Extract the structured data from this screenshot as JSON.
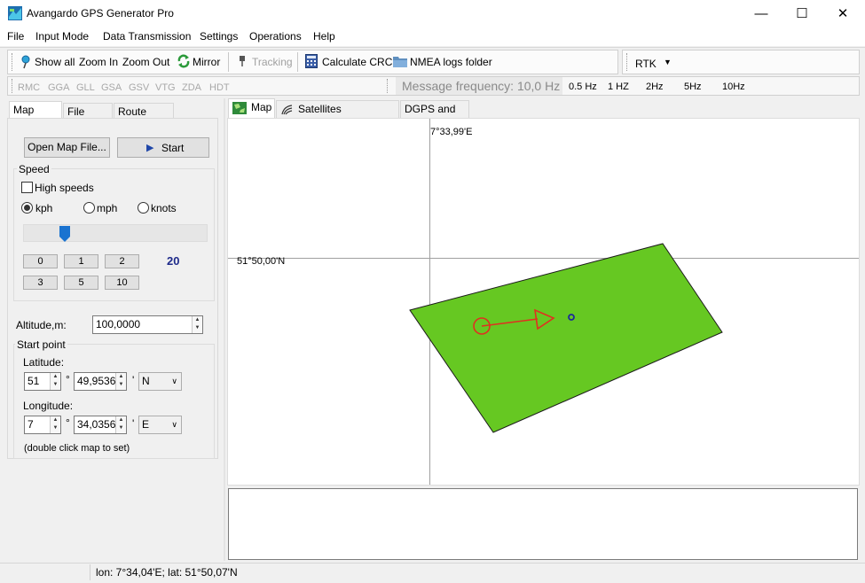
{
  "window": {
    "title": "Avangardo GPS Generator Pro",
    "minimize": "—",
    "maximize": "☐",
    "close": "✕"
  },
  "menu": [
    "File",
    "Input Mode",
    "Data Transmission",
    "Settings",
    "Operations",
    "Help"
  ],
  "toolbar": {
    "show_all": "Show all",
    "zoom_in": "Zoom In",
    "zoom_out": "Zoom Out",
    "mirror": "Mirror",
    "tracking": "Tracking",
    "calculate_crc": "Calculate CRC",
    "nmea_logs": "NMEA logs folder",
    "rtk": "RTK",
    "sentences": [
      "RMC",
      "GGA",
      "GLL",
      "GSA",
      "GSV",
      "VTG",
      "ZDA",
      "HDT"
    ],
    "message_frequency": "Message frequency: 10,0 Hz",
    "frequencies": [
      "0.5 Hz",
      "1 HZ",
      "2Hz",
      "5Hz",
      "10Hz"
    ]
  },
  "left_tabs": [
    "Map Mode",
    "File Mode",
    "Route Mode"
  ],
  "left": {
    "open_map": "Open Map File...",
    "start": "Start",
    "speed_group": "Speed",
    "high_speeds": "High speeds",
    "units": [
      "kph",
      "mph",
      "knots"
    ],
    "selected_unit": "kph",
    "speed_slider_fraction": 0.2,
    "speed_presets": [
      "0",
      "1",
      "2",
      "3",
      "5",
      "10"
    ],
    "speed_value": "20",
    "altitude_label": "Altitude,m:",
    "altitude_value": "100,0000",
    "start_point_group": "Start point",
    "latitude_label": "Latitude:",
    "lat_deg": "51",
    "lat_min": "49,9536",
    "lat_dir": "N",
    "longitude_label": "Longitude:",
    "lon_deg": "7",
    "lon_min": "34,0356",
    "lon_dir": "E",
    "degree_symbol": "°",
    "minute_symbol": "'",
    "hint": "(double click map to set)"
  },
  "map_tabs": [
    "Map",
    "Satellites Constellation",
    "DGPS and RTK"
  ],
  "map": {
    "lon_label": "7°33,99'E",
    "lat_label": "51°50,00'N",
    "area_color": "#66c822",
    "vector_color": "#e03020",
    "point_color": "#1c2a9a"
  },
  "status": {
    "coords": "lon: 7°34,04'E;  lat: 51°50,07'N"
  }
}
